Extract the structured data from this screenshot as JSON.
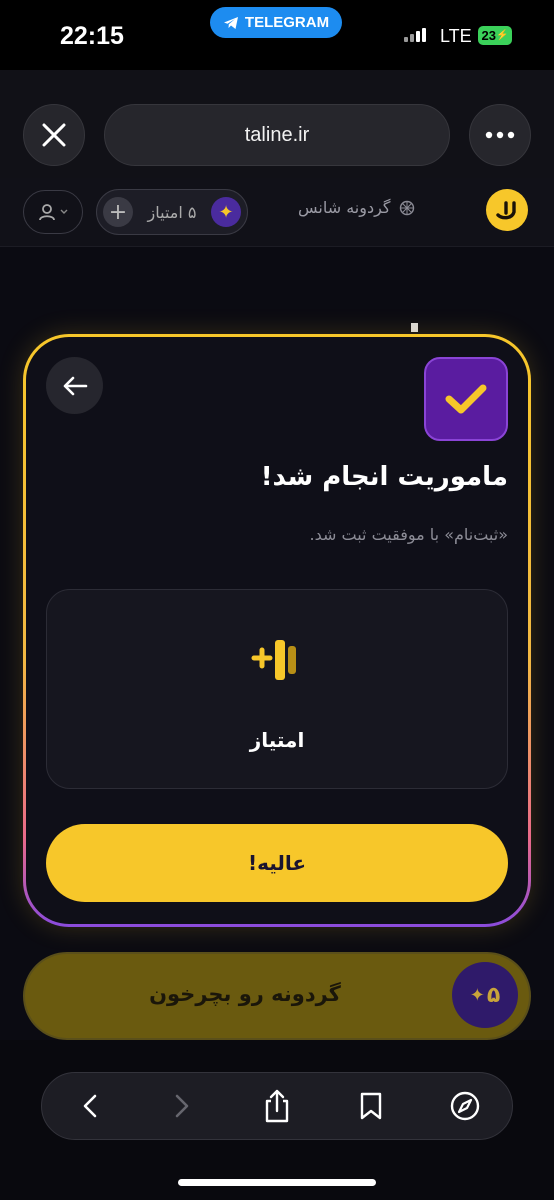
{
  "status_bar": {
    "time": "22:15",
    "telegram_label": "TELEGRAM",
    "network": "LTE",
    "battery": "23"
  },
  "browser": {
    "url": "taline.ir"
  },
  "site_header": {
    "wheel_label": "گردونه شانس",
    "points_label": "۵ امتیاز"
  },
  "modal": {
    "title": "ماموریت انجام شد!",
    "subtitle": "«ثبت‌نام» با موفقیت ثبت شد.",
    "reward_label": "امتیاز",
    "confirm_label": "عالیه!"
  },
  "spin": {
    "label": "گردونه رو بچرخون",
    "cost": "۵"
  },
  "colors": {
    "accent": "#f7c72a",
    "purple": "#5a1ca0",
    "background": "#0b0b12"
  }
}
